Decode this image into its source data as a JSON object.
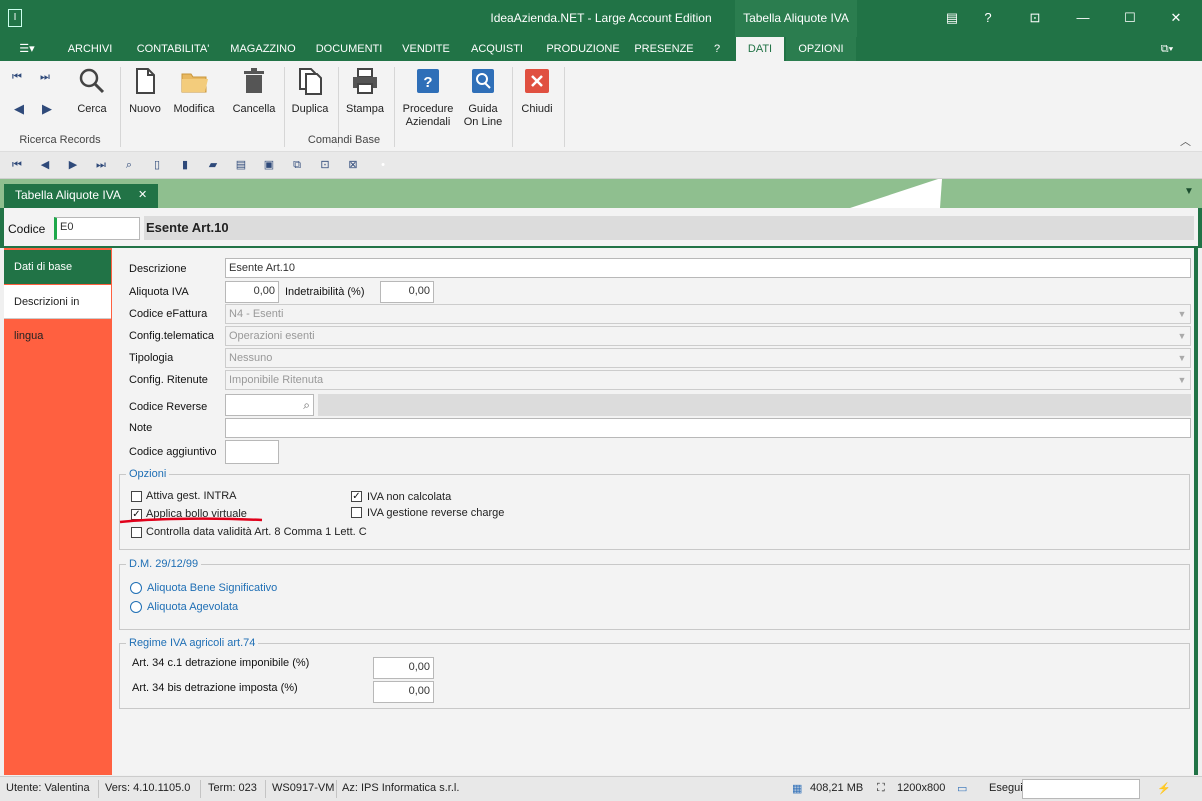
{
  "window": {
    "title": "IdeaAzienda.NET - Large Account Edition",
    "context_title": "Tabella Aliquote IVA",
    "help": "?",
    "minimize": "—",
    "maximize": "☐",
    "close": "✕"
  },
  "menu": [
    "ARCHIVI",
    "CONTABILITA'",
    "MAGAZZINO",
    "DOCUMENTI",
    "VENDITE",
    "ACQUISTI",
    "PRODUZIONE",
    "PRESENZE",
    "?",
    "DATI",
    "OPZIONI"
  ],
  "ribbon": {
    "cerca": "Cerca",
    "nuovo": "Nuovo",
    "modifica": "Modifica",
    "cancella": "Cancella",
    "duplica": "Duplica",
    "stampa": "Stampa",
    "procedure_1": "Procedure",
    "procedure_2": "Aziendali",
    "guida_1": "Guida",
    "guida_2": "On Line",
    "chiudi": "Chiudi",
    "group_ricerca": "Ricerca Records",
    "group_comandi": "Comandi Base"
  },
  "doc_tab": {
    "label": "Tabella Aliquote IVA",
    "close": "✕"
  },
  "header": {
    "codice_label": "Codice",
    "codice_value": "E0",
    "descrizione_value": "Esente Art.10"
  },
  "sidebar": [
    "Dati di base",
    "Descrizioni in lingua"
  ],
  "form": {
    "descrizione_label": "Descrizione",
    "descrizione_value": "Esente Art.10",
    "aliquota_label": "Aliquota IVA",
    "aliquota_value": "0,00",
    "indetraibilita_label": "Indetraibilità (%)",
    "indetraibilita_value": "0,00",
    "efattura_label": "Codice eFattura",
    "efattura_value": "N4 - Esenti",
    "telematica_label": "Config.telematica",
    "telematica_value": "Operazioni esenti",
    "tipologia_label": "Tipologia",
    "tipologia_value": "Nessuno",
    "ritenute_label": "Config. Ritenute",
    "ritenute_value": "Imponibile Ritenuta",
    "reverse_label": "Codice Reverse",
    "note_label": "Note",
    "aggiuntivo_label": "Codice aggiuntivo"
  },
  "opzioni": {
    "legend": "Opzioni",
    "items": [
      {
        "label": "Attiva gest. INTRA",
        "checked": false
      },
      {
        "label": "Applica bollo virtuale",
        "checked": true
      },
      {
        "label": "Controlla data validità Art. 8 Comma 1 Lett. C",
        "checked": false
      },
      {
        "label": "IVA non calcolata",
        "checked": true
      },
      {
        "label": "IVA gestione reverse charge",
        "checked": false
      }
    ]
  },
  "dm": {
    "legend": "D.M. 29/12/99",
    "opt1": "Aliquota Bene Significativo",
    "opt2": "Aliquota Agevolata"
  },
  "regime": {
    "legend": "Regime IVA agricoli art.74",
    "row1_label": "Art. 34 c.1 detrazione imponibile (%)",
    "row1_value": "0,00",
    "row2_label": "Art. 34 bis detrazione imposta (%)",
    "row2_value": "0,00"
  },
  "status": {
    "utente": "Utente: Valentina",
    "vers": "Vers: 4.10.1105.0",
    "term": "Term: 023",
    "machine": "WS0917-VM",
    "az": "Az: IPS Informatica s.r.l.",
    "memory": "408,21 MB",
    "resolution": "1200x800",
    "esegui": "Esegui"
  },
  "colors": {
    "brand": "#217346",
    "sidebar": "#ff6040",
    "accent_blue": "#1f6fb5",
    "annotation": "#e0001a"
  }
}
